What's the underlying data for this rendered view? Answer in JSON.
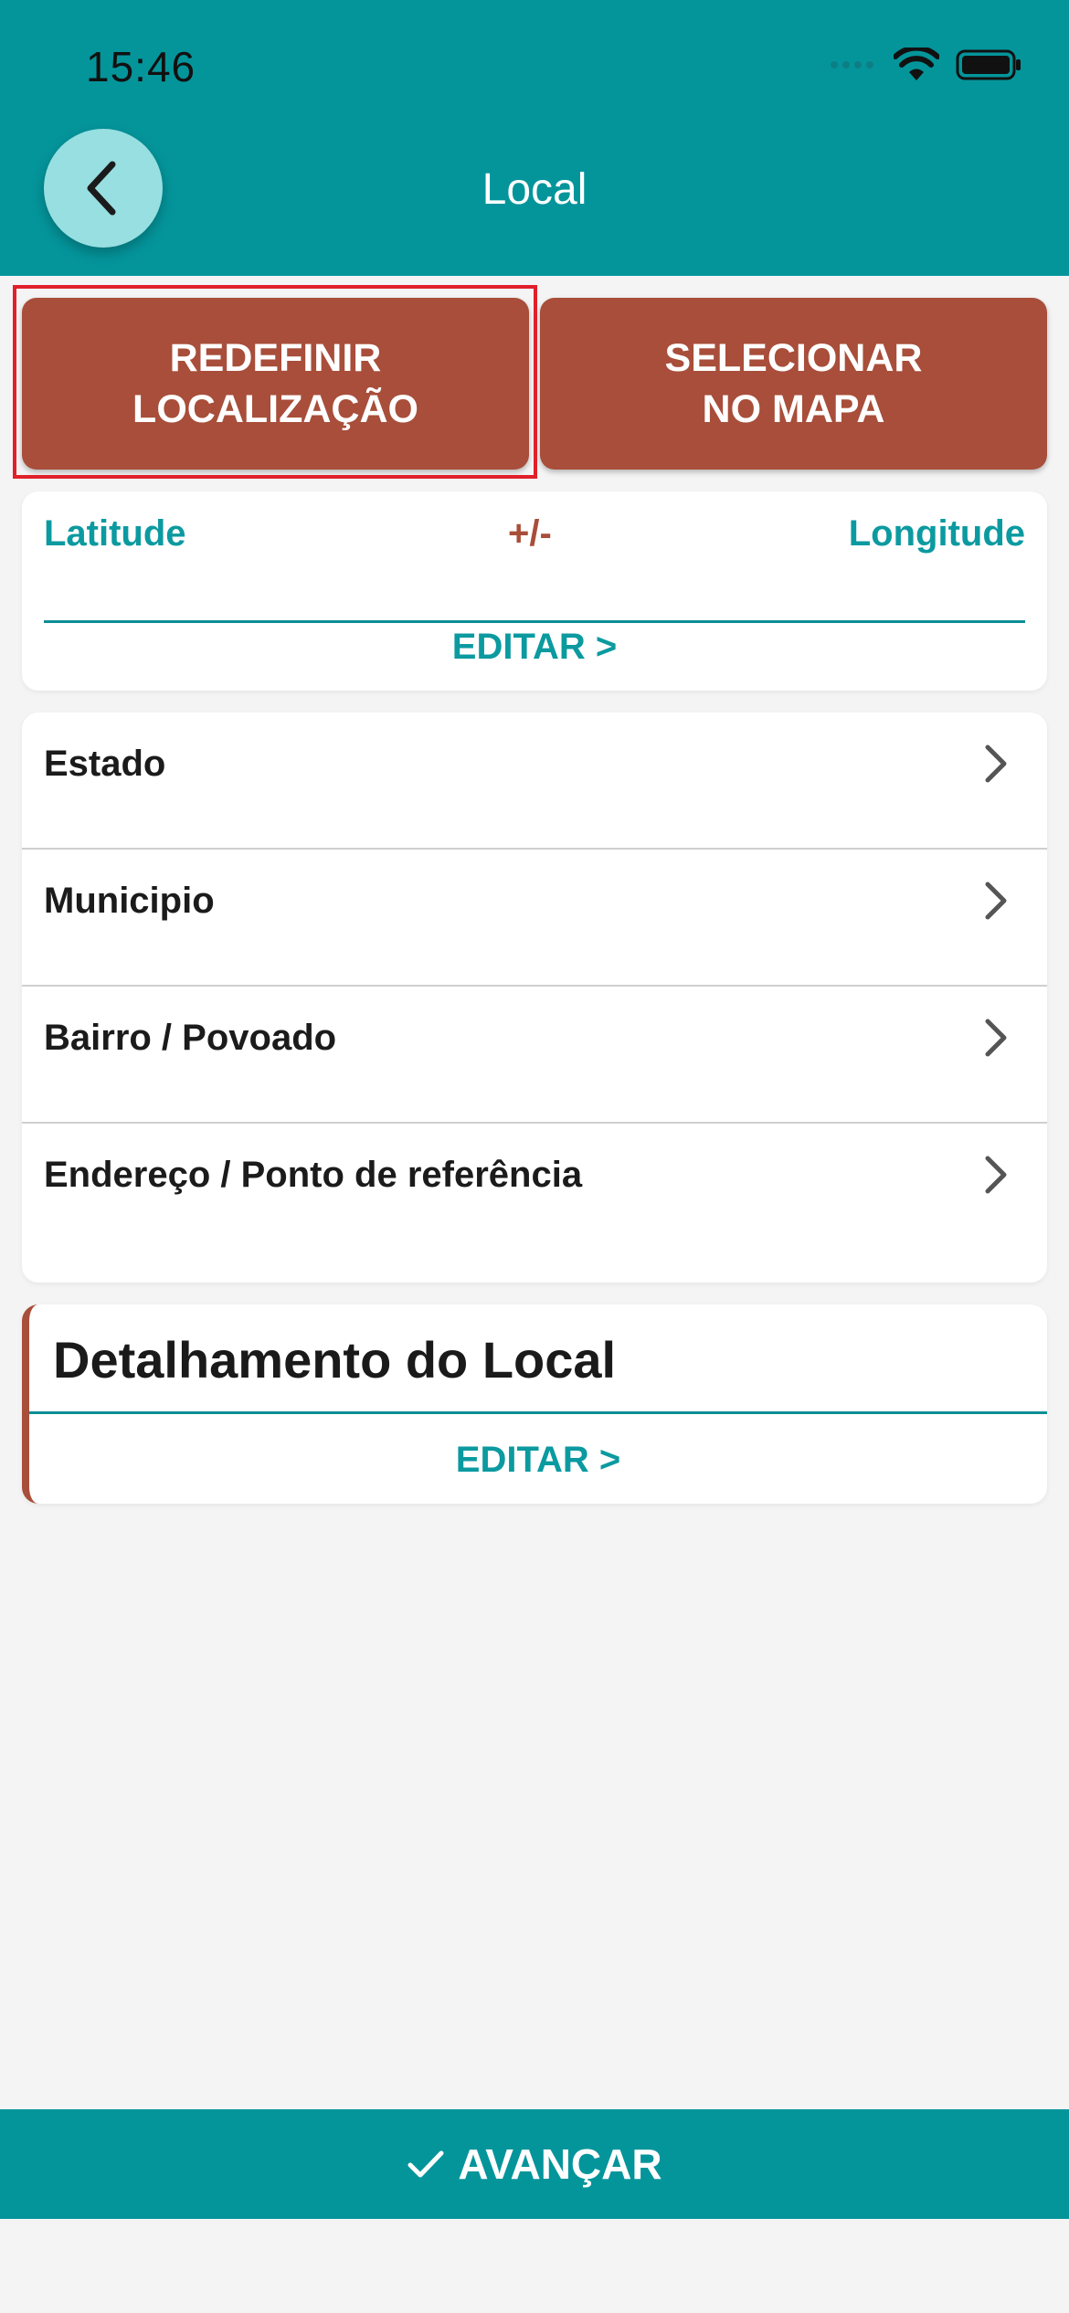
{
  "status_bar": {
    "time": "15:46"
  },
  "header": {
    "title": "Local",
    "back_icon": "chevron-left-icon"
  },
  "actions": {
    "reset_line1": "REDEFINIR",
    "reset_line2": "LOCALIZAÇÃO",
    "select_line1": "SELECIONAR",
    "select_line2": "NO MAPA"
  },
  "coordinates": {
    "latitude_label": "Latitude",
    "precision_label": "+/-",
    "longitude_label": "Longitude",
    "edit_label": "EDITAR >"
  },
  "location_list": {
    "items": [
      {
        "label": "Estado"
      },
      {
        "label": "Municipio"
      },
      {
        "label": "Bairro / Povoado"
      },
      {
        "label": "Endereço / Ponto de referência"
      }
    ]
  },
  "detail": {
    "title": "Detalhamento do Local",
    "edit_label": "EDITAR >"
  },
  "footer": {
    "label": "AVANÇAR",
    "icon": "checkmark-icon"
  },
  "colors": {
    "teal": "#04959b",
    "brick": "#a84e3a",
    "highlight": "#e0202a",
    "background": "#f4f4f4"
  }
}
